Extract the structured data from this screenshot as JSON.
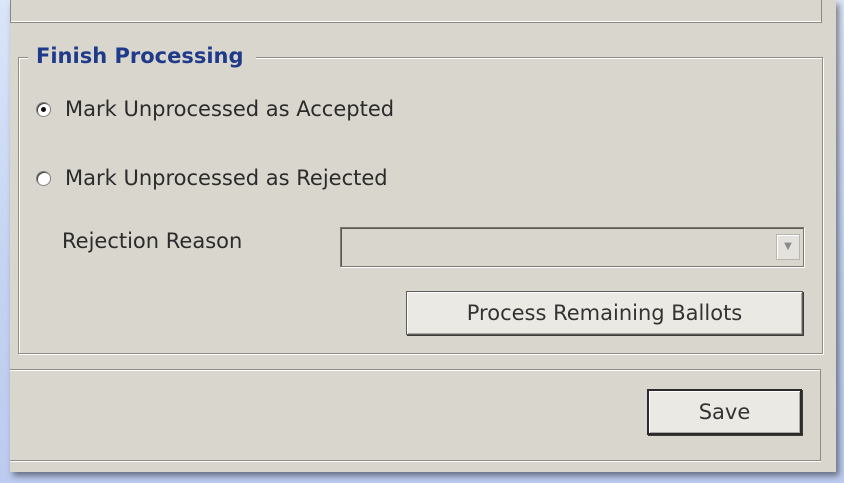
{
  "group": {
    "title": "Finish Processing"
  },
  "options": {
    "accepted_label": "Mark Unprocessed as Accepted",
    "rejected_label": "Mark Unprocessed as Rejected",
    "selected": "accepted"
  },
  "rejection": {
    "label": "Rejection Reason",
    "value": ""
  },
  "buttons": {
    "process_label": "Process Remaining Ballots",
    "save_label": "Save"
  },
  "icons": {
    "dropdown": "chevron-down-icon"
  }
}
